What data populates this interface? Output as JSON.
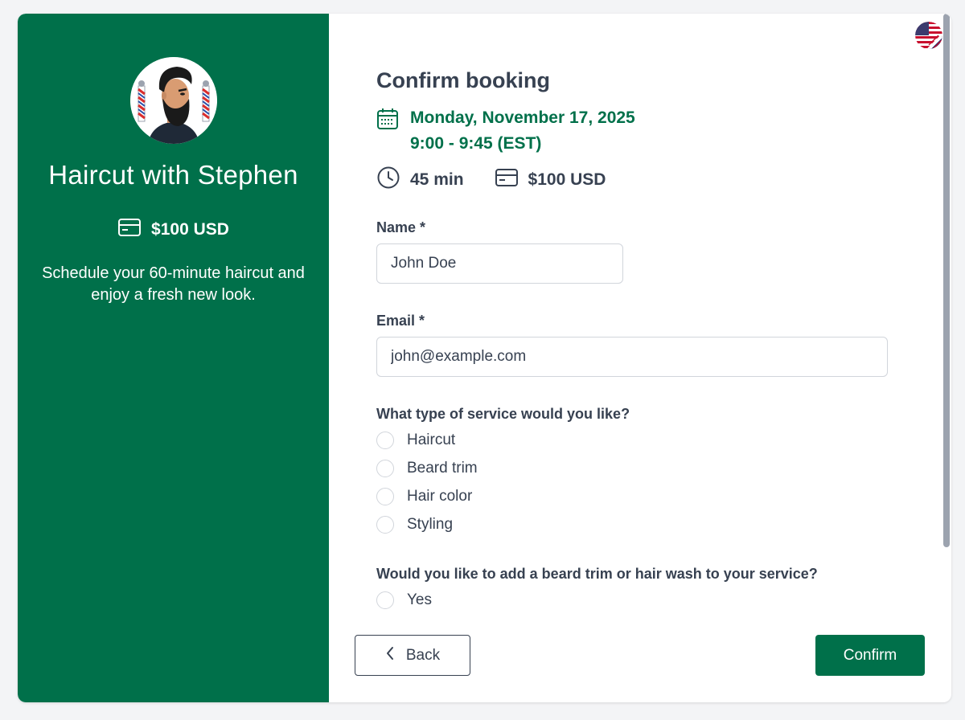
{
  "sidebar": {
    "title": "Haircut with Stephen",
    "price": "$100 USD",
    "description": "Schedule your 60-minute haircut and enjoy a fresh new look.",
    "avatar_icon": "barber-avatar-icon",
    "price_icon": "credit-card-icon"
  },
  "language": {
    "icon": "uk-us-flag-icon"
  },
  "booking": {
    "heading": "Confirm booking",
    "date": "Monday, November 17, 2025",
    "time": "9:00 - 9:45 (EST)",
    "duration": "45 min",
    "price": "$100 USD"
  },
  "form": {
    "name_label": "Name *",
    "name_value": "John Doe",
    "email_label": "Email *",
    "email_value": "john@example.com",
    "service_question": "What type of service would you like?",
    "service_options": [
      "Haircut",
      "Beard trim",
      "Hair color",
      "Styling"
    ],
    "addon_question": "Would you like to add a beard trim or hair wash to your service?",
    "addon_options": [
      "Yes"
    ]
  },
  "actions": {
    "back_label": "Back",
    "confirm_label": "Confirm"
  },
  "colors": {
    "brand": "#00704a",
    "text": "#374151",
    "border": "#d1d5db"
  }
}
